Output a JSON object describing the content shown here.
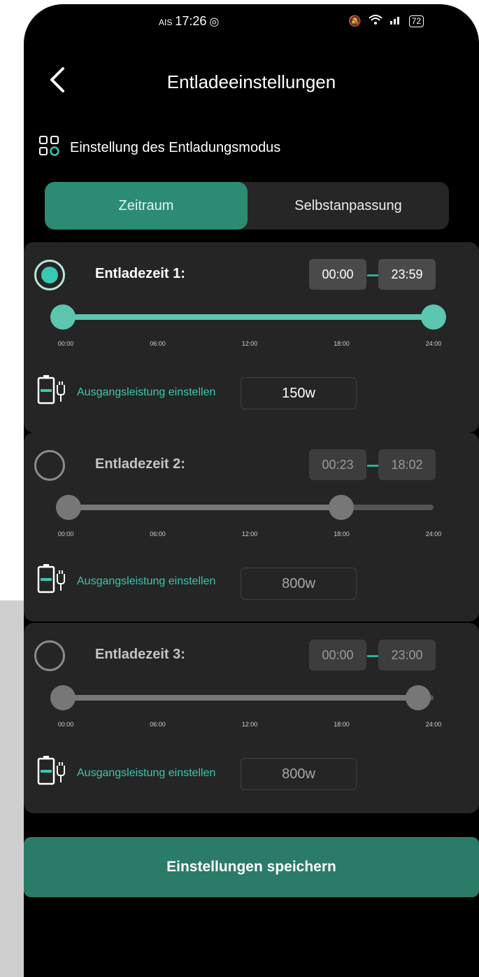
{
  "status": {
    "carrier": "AIS",
    "time": "17:26",
    "battery": "72"
  },
  "header": {
    "title": "Entladeeinstellungen"
  },
  "mode_section": {
    "label": "Einstellung des Entladungsmodus"
  },
  "tabs": [
    {
      "label": "Zeitraum",
      "active": true
    },
    {
      "label": "Selbstanpassung",
      "active": false
    }
  ],
  "ticks": [
    "00:00",
    "06:00",
    "12:00",
    "18:00",
    "24:00"
  ],
  "slots": [
    {
      "title": "Entladezeit 1:",
      "start": "00:00",
      "end": "23:59",
      "selected": true,
      "range_fraction": [
        0.0,
        0.9993
      ],
      "power_label": "Ausgangsleistung einstellen",
      "power": "150w"
    },
    {
      "title": "Entladezeit 2:",
      "start": "00:23",
      "end": "18:02",
      "selected": false,
      "range_fraction": [
        0.016,
        0.751
      ],
      "power_label": "Ausgangsleistung einstellen",
      "power": "800w"
    },
    {
      "title": "Entladezeit 3:",
      "start": "00:00",
      "end": "23:00",
      "selected": false,
      "range_fraction": [
        0.0,
        0.958
      ],
      "power_label": "Ausgangsleistung einstellen",
      "power": "800w"
    }
  ],
  "save_button": {
    "label": "Einstellungen speichern"
  },
  "colors": {
    "accent": "#2b8c73",
    "accent_light": "#5cc6b0",
    "inactive": "#777777"
  }
}
